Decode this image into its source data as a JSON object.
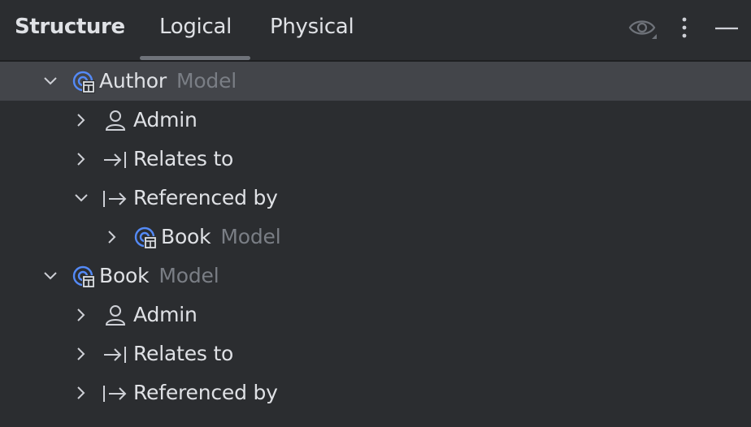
{
  "panel": {
    "title": "Structure",
    "tabs": [
      {
        "label": "Logical",
        "active": true
      },
      {
        "label": "Physical",
        "active": false
      }
    ],
    "actions": {
      "view_options_icon": "eye-icon",
      "more_icon": "more-vertical-icon",
      "hide_icon": "minimize-icon"
    }
  },
  "colors": {
    "background": "#2b2d30",
    "selected_row": "#43454a",
    "text": "#dfe1e5",
    "muted_text": "#7a7e85",
    "model_icon_blue": "#548af7"
  },
  "tree": [
    {
      "label": "Author",
      "kind": "Model",
      "expanded": true,
      "selected": true,
      "icon": "model-icon"
    },
    {
      "label": "Admin",
      "expanded": false,
      "icon": "user-icon"
    },
    {
      "label": "Relates to",
      "expanded": false,
      "icon": "relates-to-icon"
    },
    {
      "label": "Referenced by",
      "expanded": true,
      "icon": "referenced-by-icon"
    },
    {
      "label": "Book",
      "kind": "Model",
      "expanded": false,
      "icon": "model-icon"
    },
    {
      "label": "Book",
      "kind": "Model",
      "expanded": true,
      "icon": "model-icon"
    },
    {
      "label": "Admin",
      "expanded": false,
      "icon": "user-icon"
    },
    {
      "label": "Relates to",
      "expanded": false,
      "icon": "relates-to-icon"
    },
    {
      "label": "Referenced by",
      "expanded": false,
      "icon": "referenced-by-icon"
    }
  ]
}
